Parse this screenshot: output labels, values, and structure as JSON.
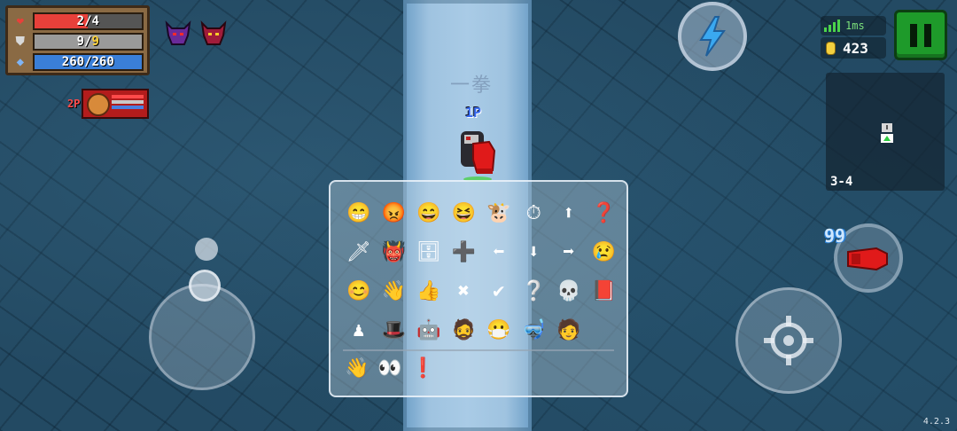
{
  "stats": {
    "hp": {
      "text": "2/4",
      "fraction": 0.5,
      "color": "#e8403a",
      "icon": "heart-icon"
    },
    "armor": {
      "current": "9",
      "max": "9",
      "fraction": 1.0,
      "color": "#9a9a9a",
      "icon": "shield-icon"
    },
    "energy": {
      "text": "260/260",
      "fraction": 1.0,
      "color": "#3a7fd8",
      "icon": "energy-crystal-icon"
    }
  },
  "buffs": [
    "purple-demon-helmet-icon",
    "red-demon-helmet-icon"
  ],
  "partner": {
    "tag": "2P"
  },
  "corridor_text": "一拳",
  "status": {
    "ping": "1ms",
    "coins": "423"
  },
  "minimap": {
    "level": "3-4"
  },
  "player": {
    "tag": "1P"
  },
  "emote_panel": {
    "rows": [
      [
        "😁",
        "😡",
        "😄",
        "😆",
        "🐮",
        "⏱",
        "⬆",
        "❓"
      ],
      [
        "🗡",
        "👹",
        "🗄",
        "➕",
        "⬅",
        "⬇",
        "➡",
        "😢"
      ],
      [
        "😊",
        "👋",
        "👍",
        "✖",
        "✔",
        "❔",
        "💀",
        "📕"
      ],
      [
        "♟",
        "🎩",
        "🤖",
        "🧔",
        "😷",
        "🤿",
        "🧑"
      ]
    ],
    "bottom": [
      "👋",
      "👀",
      "❗"
    ]
  },
  "weapon": {
    "ammo": "99"
  },
  "version": "4.2.3"
}
